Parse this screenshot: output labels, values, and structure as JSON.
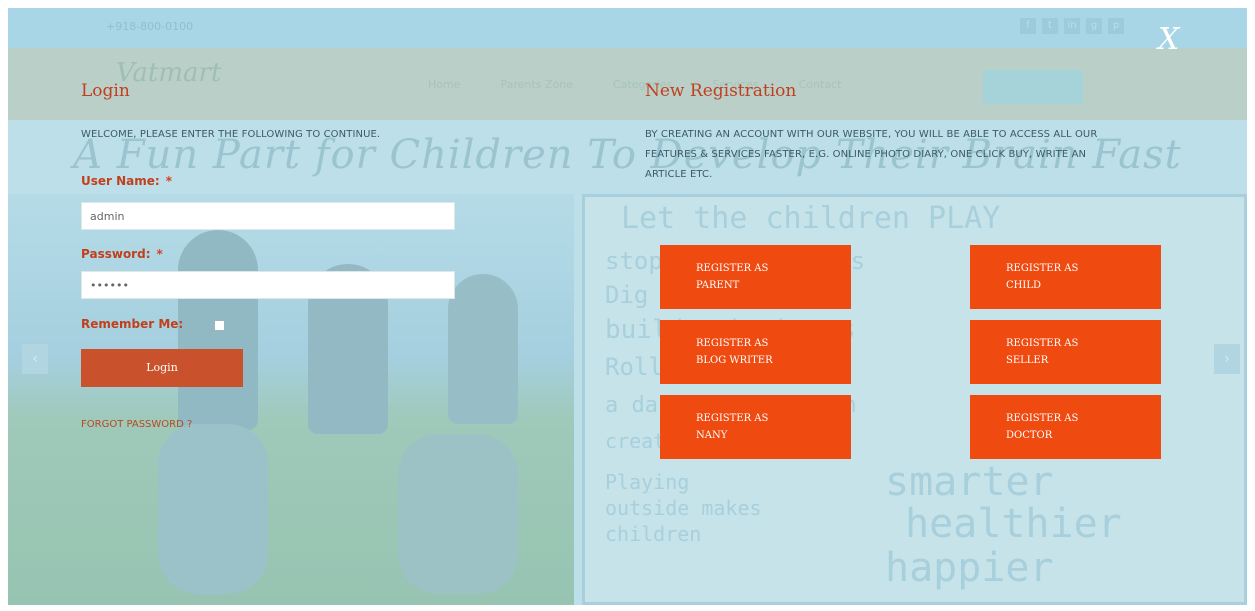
{
  "background_site": {
    "phone": "+918-800-0100",
    "social": [
      "f",
      "t",
      "in",
      "g",
      "p"
    ],
    "logo": "Vatmart",
    "menu": [
      "Home",
      "Parents Zone",
      "Categories",
      "Services",
      "Contact"
    ],
    "tagline": "A Fun Part for Children To Develop Their Brain Fast",
    "board_lines": [
      "Let the children PLAY",
      "stop PUDDLES trees",
      "Dig Dirt",
      "build make homes",
      "Roll in a field",
      "a dance make a rain",
      "create gardens",
      "Playing outside makes children",
      "smarter",
      "healthier",
      "happier"
    ]
  },
  "modal": {
    "close_label": "X",
    "login": {
      "title": "Login",
      "intro": "WELCOME, PLEASE ENTER THE FOLLOWING TO CONTINUE.",
      "username_label": "User Name:",
      "username_value": "admin",
      "password_label": "Password:",
      "password_value": "••••••",
      "required_mark": "*",
      "remember_label": "Remember Me:",
      "submit_label": "Login",
      "forgot_label": "FORGOT PASSWORD ?"
    },
    "registration": {
      "title": "New Registration",
      "intro_line1": "BY CREATING AN ACCOUNT WITH OUR WEBSITE, YOU WILL BE ABLE TO ACCESS ALL OUR",
      "intro_line2": "FEATURES & SERVICES FASTER, E.G. ONLINE PHOTO DIARY, ONE CLICK BUY, WRITE AN",
      "intro_line3": "ARTICLE ETC.",
      "buttons": [
        {
          "line1": "REGISTER AS",
          "line2": "PARENT"
        },
        {
          "line1": "REGISTER AS",
          "line2": "CHILD"
        },
        {
          "line1": "REGISTER AS",
          "line2": "BLOG WRITER"
        },
        {
          "line1": "REGISTER AS",
          "line2": "SELLER"
        },
        {
          "line1": "REGISTER AS",
          "line2": "NANY"
        },
        {
          "line1": "REGISTER AS",
          "line2": "DOCTOR"
        }
      ]
    }
  },
  "colors": {
    "overlay": "#bcdfe9",
    "heading": "#c23f1e",
    "login_button": "#c9522c",
    "register_button": "#ef4a10"
  }
}
